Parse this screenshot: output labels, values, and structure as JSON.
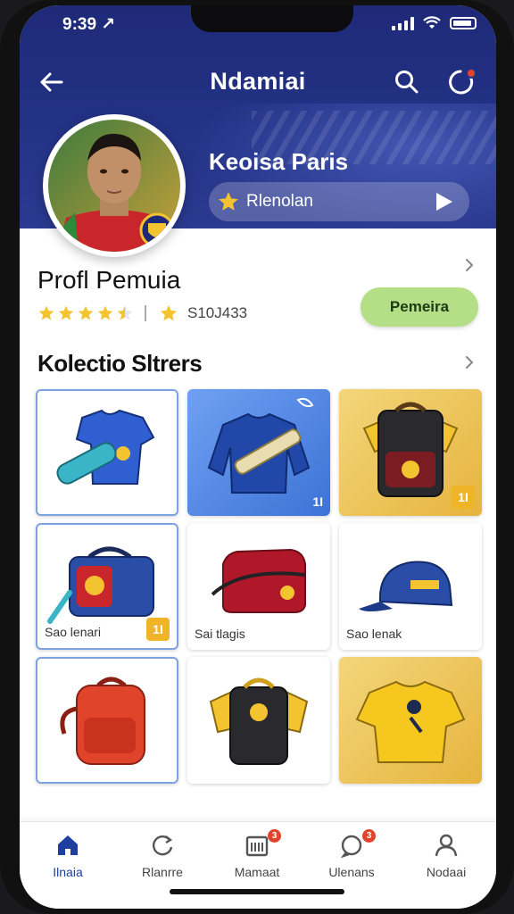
{
  "status_bar": {
    "time": "9:39 ↗"
  },
  "header": {
    "title": "Ndamiai"
  },
  "hero": {
    "team_name": "Keoisa Paris",
    "pill_label": "Rlenolan"
  },
  "profile": {
    "title": "Profl Pemuia",
    "rating_stars": 4.5,
    "rating_score": "S10J433",
    "follow_label": "Pemeira"
  },
  "collection": {
    "title": "Kolectio Sltrers",
    "items": [
      {
        "caption": "",
        "badge": ""
      },
      {
        "caption": "",
        "badge": "1I"
      },
      {
        "caption": "",
        "badge": "1I"
      },
      {
        "caption": "Sao lenari",
        "badge": "1I"
      },
      {
        "caption": "Sai tlagis",
        "badge": ""
      },
      {
        "caption": "Sao lenak",
        "badge": ""
      },
      {
        "caption": "",
        "badge": ""
      },
      {
        "caption": "",
        "badge": ""
      },
      {
        "caption": "",
        "badge": ""
      }
    ]
  },
  "bottom_nav": {
    "items": [
      {
        "label": "Ilnaia",
        "icon": "home-icon",
        "active": true,
        "badge": ""
      },
      {
        "label": "Rlanrre",
        "icon": "refresh-icon",
        "active": false,
        "badge": ""
      },
      {
        "label": "Mamaat",
        "icon": "calendar-icon",
        "active": false,
        "badge": "3"
      },
      {
        "label": "Ulenans",
        "icon": "chat-icon",
        "active": false,
        "badge": "3"
      },
      {
        "label": "Nodaai",
        "icon": "profile-icon",
        "active": false,
        "badge": ""
      }
    ]
  },
  "colors": {
    "primary": "#243286",
    "accent_green": "#b5df87",
    "star": "#f4c430",
    "badge": "#f0b429"
  }
}
